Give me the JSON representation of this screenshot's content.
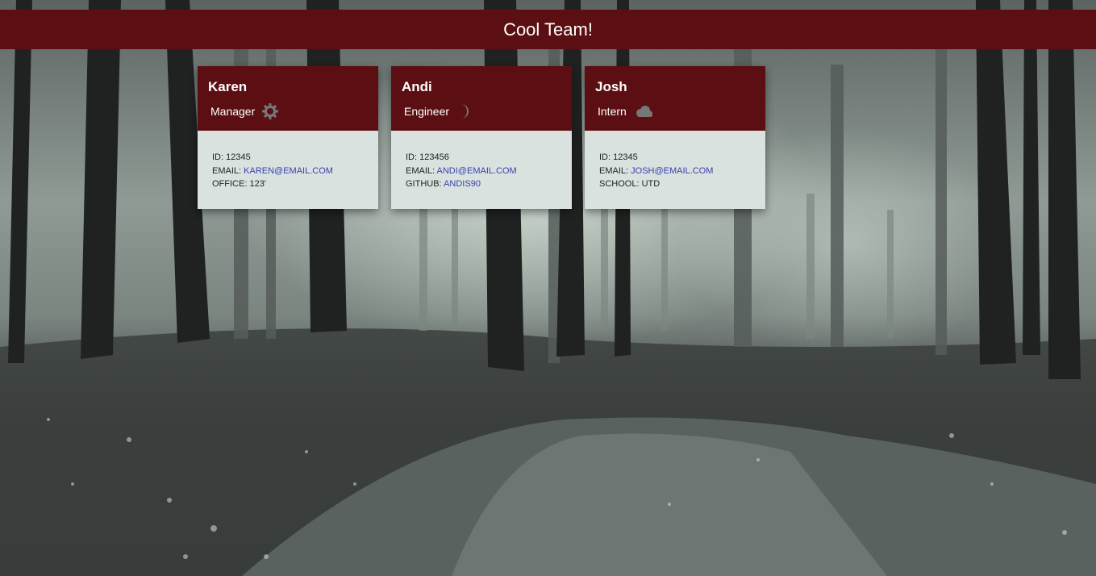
{
  "header": {
    "title": "Cool Team!"
  },
  "colors": {
    "header_bg": "#5b0f13",
    "card_body_bg": "#d9e2df",
    "link": "#3a3fb0"
  },
  "employees": [
    {
      "name": "Karen",
      "role": "Manager",
      "role_icon": "gear-icon",
      "id_label": "ID:",
      "id": "12345",
      "email_label": "EMAIL:",
      "email": "KAREN@EMAIL.COM",
      "extra_label": "OFFICE:",
      "extra": "123'"
    },
    {
      "name": "Andi",
      "role": "Engineer",
      "role_icon": "moon-icon",
      "id_label": "ID:",
      "id": "123456",
      "email_label": "EMAIL:",
      "email": "ANDI@EMAIL.COM",
      "extra_label": "GITHUB:",
      "extra": "ANDIS90"
    },
    {
      "name": "Josh",
      "role": "Intern",
      "role_icon": "cloud-icon",
      "id_label": "ID:",
      "id": "12345",
      "email_label": "EMAIL:",
      "email": "JOSH@EMAIL.COM",
      "extra_label": "SCHOOL:",
      "extra": "UTD"
    }
  ]
}
